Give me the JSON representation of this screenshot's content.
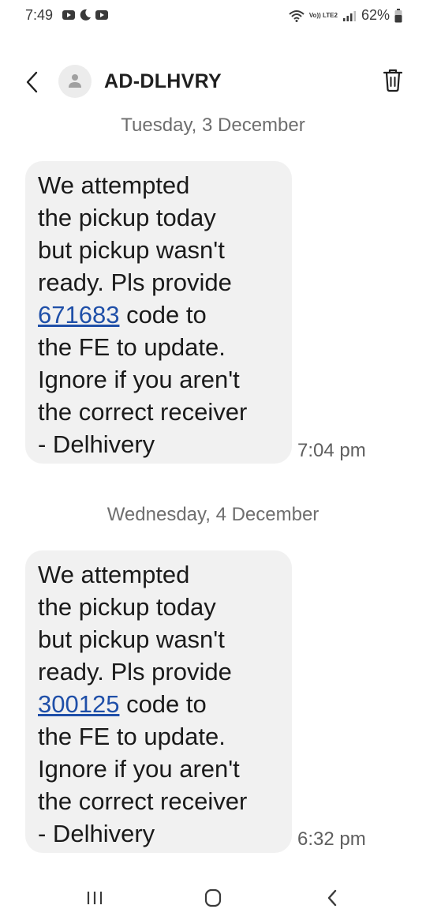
{
  "status_bar": {
    "time": "7:49",
    "network_label": "Vo)) LTE2",
    "battery": "62%"
  },
  "header": {
    "contact_name": "AD-DLHVRY"
  },
  "messages": [
    {
      "date": "Tuesday, 3 December",
      "lines_before": [
        "We attempted",
        "the pickup today",
        "but pickup wasn't",
        "ready. Pls provide"
      ],
      "code": "671683",
      "after_code": " code to",
      "lines_after": [
        "the FE to update.",
        "Ignore if you aren't",
        "the correct receiver",
        "- Delhivery"
      ],
      "time": "7:04 pm"
    },
    {
      "date": "Wednesday, 4 December",
      "lines_before": [
        "We attempted",
        "the pickup today",
        "but pickup wasn't",
        "ready. Pls provide"
      ],
      "code": "300125",
      "after_code": " code to",
      "lines_after": [
        "the FE to update.",
        "Ignore if you aren't",
        "the correct receiver",
        "- Delhivery"
      ],
      "time": "6:32 pm"
    }
  ],
  "icons": {
    "back": "back-arrow-icon",
    "avatar": "person-icon",
    "delete": "trash-icon",
    "nav_recents": "recents-icon",
    "nav_home": "home-icon",
    "nav_back": "nav-back-icon"
  }
}
